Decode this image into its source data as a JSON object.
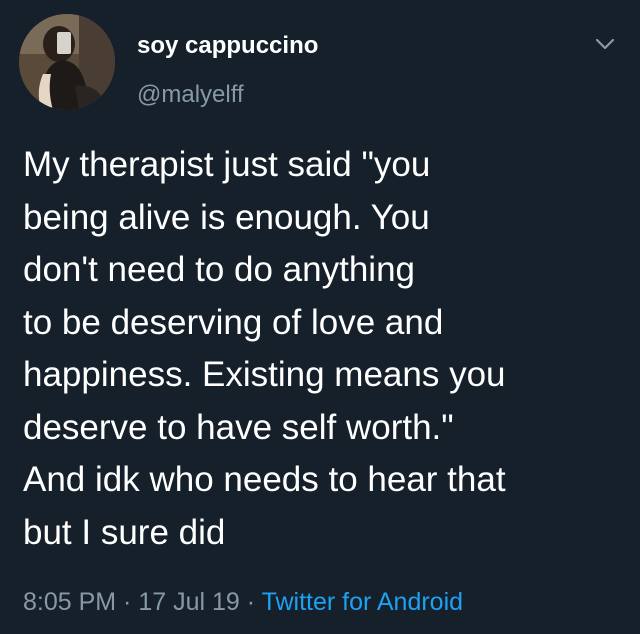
{
  "user": {
    "display_name": "soy cappuccino",
    "handle": "@malyelff"
  },
  "tweet": {
    "lines": [
      "My therapist just said \"you",
      "being alive is enough. You",
      "don't need to do anything",
      "to be deserving of love and",
      "happiness. Existing means you",
      "deserve to have self worth.\"",
      "And idk who needs to hear that",
      "but I sure did"
    ]
  },
  "meta": {
    "time": "8:05 PM",
    "separator": " · ",
    "date": "17 Jul 19",
    "source": "Twitter for Android"
  },
  "colors": {
    "background": "#15202b",
    "primary_text": "#ffffff",
    "secondary_text": "#8899a6",
    "link": "#1da1f2"
  },
  "icons": {
    "menu": "chevron-down-icon"
  }
}
